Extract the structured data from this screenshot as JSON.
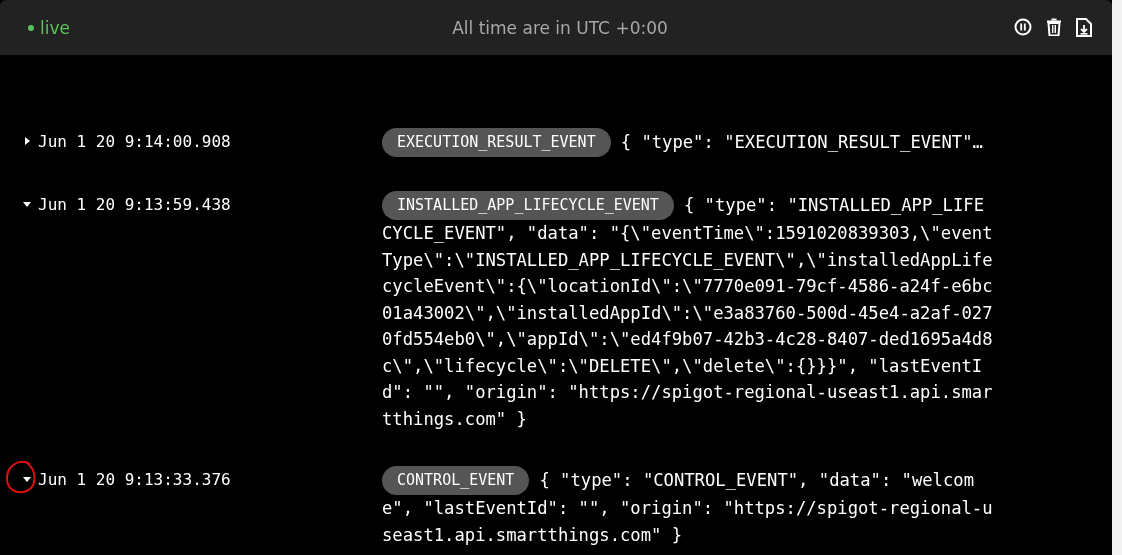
{
  "header": {
    "status": {
      "label": "live",
      "live": true
    },
    "timezone_note": "All time are in UTC +0:00"
  },
  "events": [
    {
      "timestamp": "Jun 1 20 9:14:00.908",
      "expanded": false,
      "marked": false,
      "type": "EXECUTION_RESULT_EVENT",
      "payload": "{ \"type\": \"EXECUTION_RESULT_EVENT\"…"
    },
    {
      "timestamp": "Jun 1 20 9:13:59.438",
      "expanded": true,
      "marked": false,
      "type": "INSTALLED_APP_LIFECYCLE_EVENT",
      "payload": "{ \"type\": \"INSTALLED_APP_LIFECYCLE_EVENT\", \"data\": \"{\\\"eventTime\\\":1591020839303,\\\"eventType\\\":\\\"INSTALLED_APP_LIFECYCLE_EVENT\\\",\\\"installedAppLifecycleEvent\\\":{\\\"locationId\\\":\\\"7770e091-79cf-4586-a24f-e6bc01a43002\\\",\\\"installedAppId\\\":\\\"e3a83760-500d-45e4-a2af-0270fd554eb0\\\",\\\"appId\\\":\\\"ed4f9b07-42b3-4c28-8407-ded1695a4d8c\\\",\\\"lifecycle\\\":\\\"DELETE\\\",\\\"delete\\\":{}}}\", \"lastEventId\": \"\", \"origin\": \"https://spigot-regional-useast1.api.smartthings.com\" }"
    },
    {
      "timestamp": "Jun 1 20 9:13:33.376",
      "expanded": true,
      "marked": true,
      "type": "CONTROL_EVENT",
      "payload": "{ \"type\": \"CONTROL_EVENT\", \"data\": \"welcome\", \"lastEventId\": \"\", \"origin\": \"https://spigot-regional-useast1.api.smartthings.com\" }"
    }
  ]
}
